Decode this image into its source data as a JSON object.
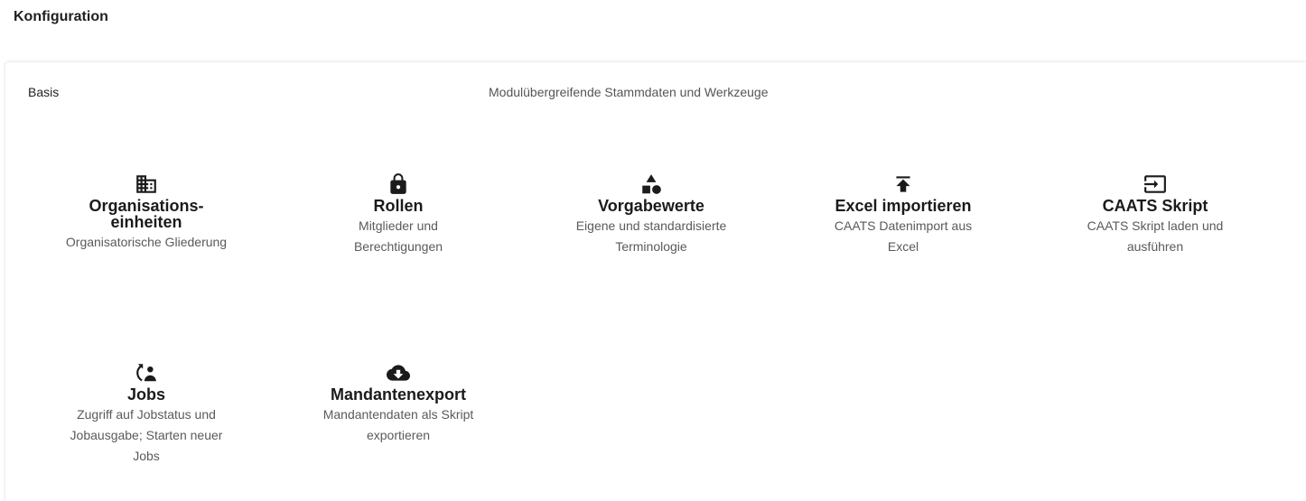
{
  "page": {
    "title": "Konfiguration"
  },
  "section": {
    "title": "Basis",
    "description": "Modulübergreifende Stammdaten und Werkzeuge"
  },
  "tiles": [
    {
      "icon": "building-icon",
      "title": "Organisations- einheiten",
      "description": "Organisatorische Gliederung"
    },
    {
      "icon": "lock-icon",
      "title": "Rollen",
      "description": "Mitglieder und Berechtigungen"
    },
    {
      "icon": "shapes-icon",
      "title": "Vorgabewerte",
      "description": "Eigene und standardisierte Terminologie"
    },
    {
      "icon": "upload-icon",
      "title": "Excel importieren",
      "description": "CAATS Datenimport aus Excel"
    },
    {
      "icon": "input-icon",
      "title": "CAATS Skript",
      "description": "CAATS Skript laden und ausführen"
    },
    {
      "icon": "job-sync-icon",
      "title": "Jobs",
      "description": "Zugriff auf Jobstatus und Jobausgabe; Starten neuer Jobs"
    },
    {
      "icon": "cloud-download-icon",
      "title": "Mandantenexport",
      "description": "Mandantendaten als Skript exportieren"
    }
  ]
}
